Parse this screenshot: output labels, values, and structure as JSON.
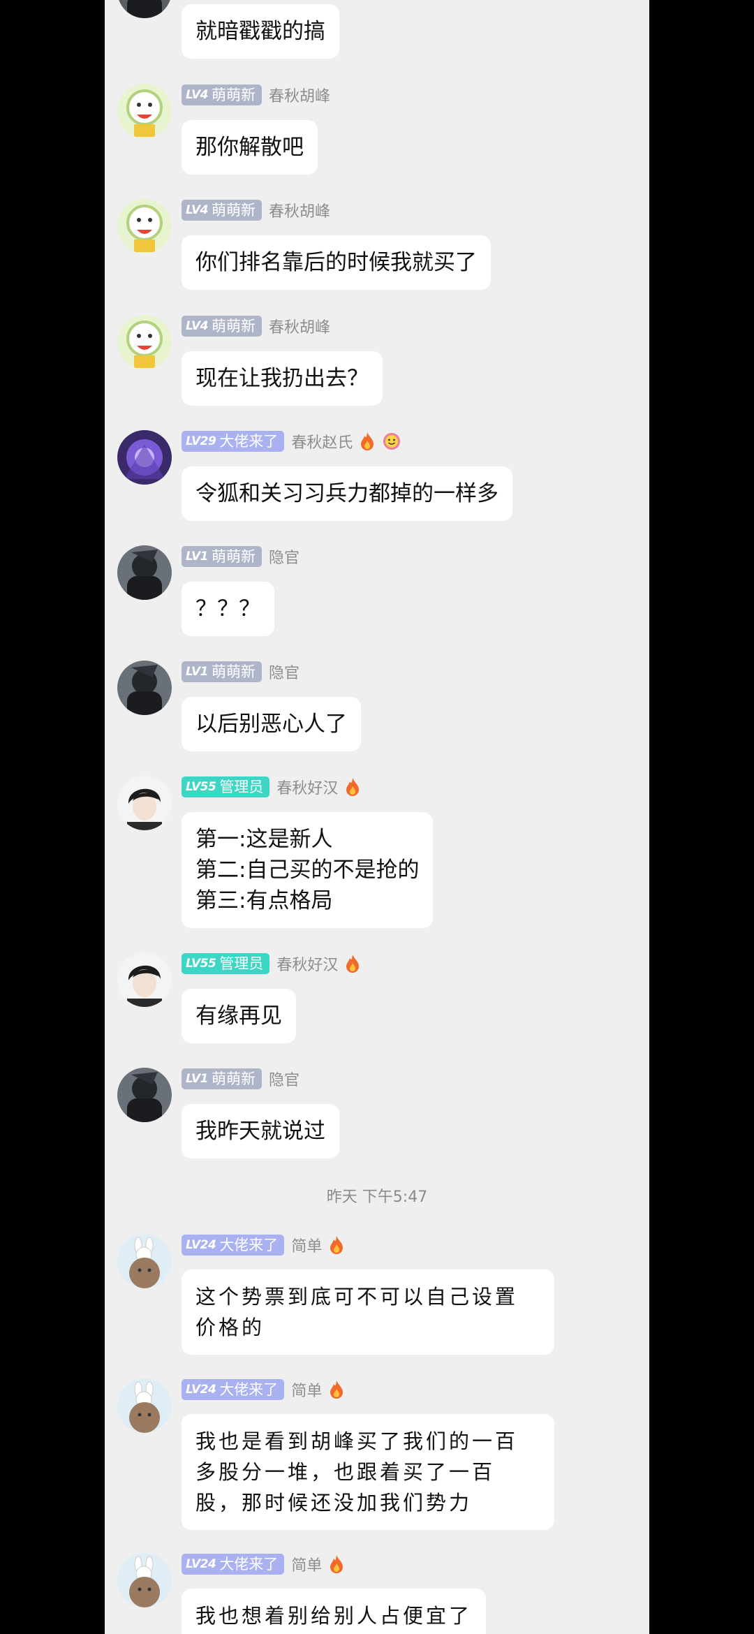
{
  "messages": [
    {
      "text": "就暗戳戳的搞"
    },
    {
      "badge_lv": "LV4",
      "badge_title": "萌萌新",
      "name": "春秋胡峰",
      "text": "那你解散吧"
    },
    {
      "badge_lv": "LV4",
      "badge_title": "萌萌新",
      "name": "春秋胡峰",
      "text": "你们排名靠后的时候我就买了"
    },
    {
      "badge_lv": "LV4",
      "badge_title": "萌萌新",
      "name": "春秋胡峰",
      "text": "现在让我扔出去？"
    },
    {
      "badge_lv": "LV29",
      "badge_title": "大佬来了",
      "name": "春秋赵氏",
      "text": "令狐和关习习兵力都掉的一样多"
    },
    {
      "badge_lv": "LV1",
      "badge_title": "萌萌新",
      "name": "隐官",
      "text": "？？？"
    },
    {
      "badge_lv": "LV1",
      "badge_title": "萌萌新",
      "name": "隐官",
      "text": "以后别恶心人了"
    },
    {
      "badge_lv": "LV55",
      "badge_title": "管理员",
      "name": "春秋好汉",
      "lines": [
        "第一:这是新人",
        "第二:自己买的不是抢的",
        "第三:有点格局"
      ]
    },
    {
      "badge_lv": "LV55",
      "badge_title": "管理员",
      "name": "春秋好汉",
      "text": "有缘再见"
    },
    {
      "badge_lv": "LV1",
      "badge_title": "萌萌新",
      "name": "隐官",
      "text": "我昨天就说过"
    },
    {
      "badge_lv": "LV24",
      "badge_title": "大佬来了",
      "name": "简单",
      "text": "这个势票到底可不可以自己设置价格的"
    },
    {
      "badge_lv": "LV24",
      "badge_title": "大佬来了",
      "name": "简单",
      "text": "我也是看到胡峰买了我们的一百多股分一堆，也跟着买了一百股，那时候还没加我们势力"
    },
    {
      "badge_lv": "LV24",
      "badge_title": "大佬来了",
      "name": "简单",
      "text": "我也想着别给别人占便宜了"
    }
  ],
  "timestamp": "昨天 下午5:47",
  "colors": {
    "badge_gray": "#aeb5c9",
    "badge_purple": "#a9b1f0",
    "badge_teal": "#3dd6c5",
    "fire": "#f06a2a"
  }
}
